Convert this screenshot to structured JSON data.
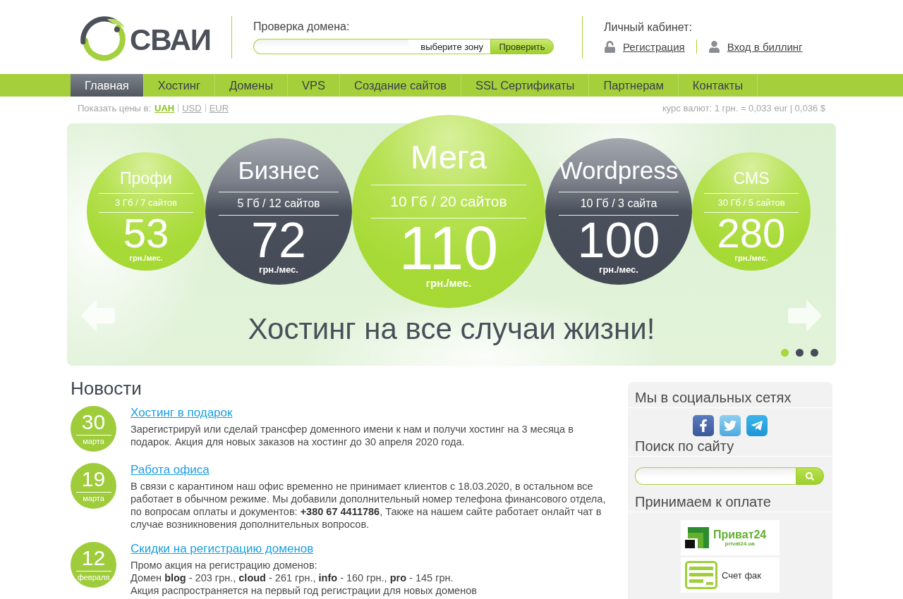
{
  "header": {
    "logo": {
      "text": "СВАИ"
    },
    "domain_check": {
      "label": "Проверка домена:",
      "zone": "выберите зону",
      "button": "Проверить"
    },
    "account": {
      "label": "Личный кабинет:",
      "links": [
        {
          "kind": "register",
          "label": "Регистрация"
        },
        {
          "kind": "login",
          "label": "Вход в биллинг"
        }
      ]
    }
  },
  "nav": [
    {
      "label": "Главная",
      "selected": true
    },
    {
      "label": "Хостинг",
      "selected": false
    },
    {
      "label": "Домены",
      "selected": false
    },
    {
      "label": "VPS",
      "selected": false
    },
    {
      "label": "Создание сайтов",
      "selected": false
    },
    {
      "label": "SSL Сертификаты",
      "selected": false
    },
    {
      "label": "Партнерам",
      "selected": false
    },
    {
      "label": "Контакты",
      "selected": false
    }
  ],
  "currency": {
    "label": "Показать цены в:",
    "options": [
      {
        "label": "UAH",
        "selected": true
      },
      {
        "label": "USD",
        "selected": false
      },
      {
        "label": "EUR",
        "selected": false
      }
    ],
    "rate": "курс валют: 1 грн. = 0,033 eur | 0,036 $"
  },
  "banner": {
    "plans": [
      {
        "kind": "basic",
        "name": "Профи",
        "spec": "3 Гб / 7 сайтов",
        "price": "53",
        "unit": "грн./мес."
      },
      {
        "kind": "advanced",
        "name": "Бизнес",
        "spec": "5 Гб / 12 сайтов",
        "price": "72",
        "unit": "грн./мес."
      },
      {
        "kind": "featured",
        "name": "Мега",
        "spec": "10 Гб / 20 сайтов",
        "price": "110",
        "unit": "грн./мес."
      },
      {
        "kind": "advanced",
        "name": "Wordpress",
        "spec": "10 Гб / 3 сайта",
        "price": "100",
        "unit": "грн./мес."
      },
      {
        "kind": "basic",
        "name": "CMS",
        "spec": "30 Гб / 5 сайтов",
        "price": "280",
        "unit": "грн./мес."
      }
    ],
    "tagline": "Хостинг на все случаи жизни!",
    "dots": [
      {
        "selected": true
      },
      {
        "selected": false
      },
      {
        "selected": false
      }
    ]
  },
  "news": {
    "title": "Новости",
    "items": [
      {
        "day": "30",
        "month": "марта",
        "title": "Хостинг в подарок",
        "text": "Зарегистрируй или сделай трансфер доменного имени к нам и получи хостинг на 3 месяца в подарок. Акция для новых заказов на хостинг до 30 апреля 2020 года."
      },
      {
        "day": "19",
        "month": "марта",
        "title": "Работа офиса",
        "text": "В связи с карантином наш офис временно не принимает клиентов с 18.03.2020, в остальном все работает в обычном режиме. Мы добавили дополнительный номер телефона финансового отдела, по вопросам оплаты и документов: **+380 67 4411786**, Также на нашем сайте работает онлайт чат в случае возникновения дополнительных вопросов."
      },
      {
        "day": "12",
        "month": "февраля",
        "title": "Скидки на регистрацию доменов",
        "text": "Промо акция на регистрацию доменов:\nДомен **blog** - 203 грн., **cloud** - 261 грн., **info** - 160 грн., **pro** - 145 грн.\nАкция распространяется на первый год регистрации для новых доменов"
      }
    ]
  },
  "sidebar": {
    "social": {
      "title": "Мы в социальных сетях",
      "networks": [
        {
          "kind": "facebook"
        },
        {
          "kind": "twitter"
        },
        {
          "kind": "telegram"
        }
      ]
    },
    "search": {
      "title": "Поиск по сайту"
    },
    "payment": {
      "title": "Принимаем к оплате",
      "methods": [
        {
          "kind": "privat24",
          "title": "Приват24",
          "caption": "privat24.ua"
        },
        {
          "kind": "invoice",
          "title": "Счет фак"
        }
      ]
    }
  }
}
